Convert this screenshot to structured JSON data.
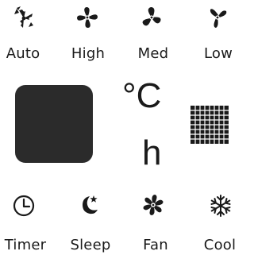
{
  "modes_top": [
    {
      "label": "Auto",
      "icon": "auto-fan-icon"
    },
    {
      "label": "High",
      "icon": "fan-high-icon"
    },
    {
      "label": "Med",
      "icon": "fan-med-icon"
    },
    {
      "label": "Low",
      "icon": "fan-low-icon"
    }
  ],
  "units": {
    "temperature": "°C",
    "hours": "h"
  },
  "modes_bottom": [
    {
      "label": "Timer",
      "icon": "clock-icon"
    },
    {
      "label": "Sleep",
      "icon": "moon-star-icon"
    },
    {
      "label": "Fan",
      "icon": "fan-icon"
    },
    {
      "label": "Cool",
      "icon": "snowflake-icon"
    }
  ],
  "colors": {
    "foreground": "#1a1a1a",
    "display": "#2b2b2b",
    "background": "#ffffff"
  }
}
